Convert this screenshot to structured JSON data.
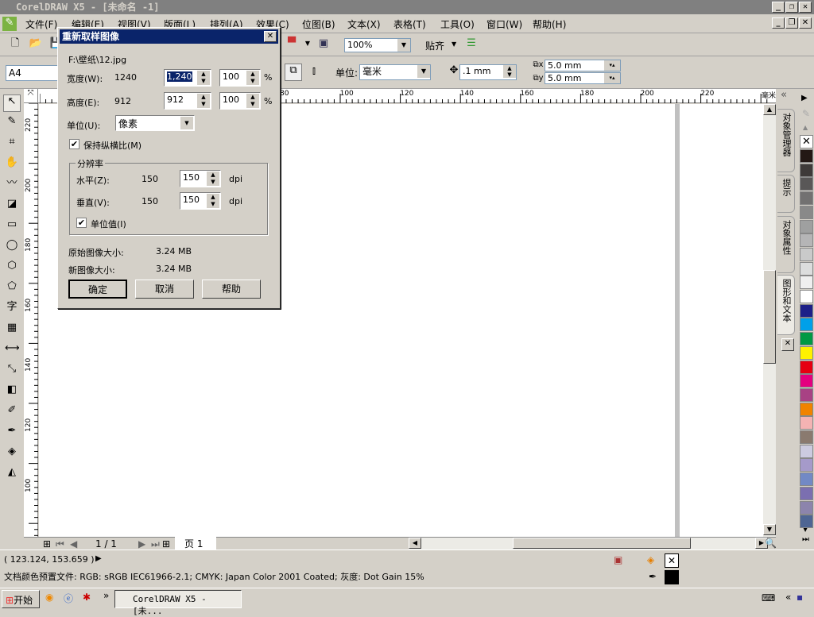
{
  "window": {
    "title": "CorelDRAW X5 - [未命名 -1]"
  },
  "menu": [
    "文件(F)",
    "编辑(E)",
    "视图(V)",
    "版面(L)",
    "排列(A)",
    "效果(C)",
    "位图(B)",
    "文本(X)",
    "表格(T)",
    "工具(O)",
    "窗口(W)",
    "帮助(H)"
  ],
  "toolbar": {
    "zoom": "100%",
    "snap": "贴齐"
  },
  "propbar": {
    "page_size": "A4",
    "unit_label": "单位:",
    "unit": "毫米",
    "nudge": ".1 mm",
    "dup_x": "5.0 mm",
    "dup_y": "5.0 mm"
  },
  "ruler": {
    "top": [
      "80",
      "100",
      "120",
      "140",
      "160",
      "180",
      "200",
      "220"
    ],
    "left": [
      "220",
      "200",
      "180",
      "160",
      "140",
      "120",
      "100"
    ],
    "unit": "毫米"
  },
  "tools": [
    "pick",
    "shape",
    "crop",
    "pan",
    "freehand",
    "smart-fill",
    "rectangle",
    "ellipse",
    "polygon",
    "basic-shapes",
    "字",
    "table",
    "dimension",
    "connector",
    "blend",
    "eyedropper",
    "outline",
    "fill",
    "interactive-fill"
  ],
  "pages": {
    "counter": "1 / 1",
    "tab": "页 1"
  },
  "dockers": [
    "对象管理器",
    "提示",
    "对象属性",
    "图形和文本"
  ],
  "palette": [
    "#231815",
    "#3e3a39",
    "#595757",
    "#727171",
    "#898989",
    "#9fa0a0",
    "#b5b5b6",
    "#c9caca",
    "#dcdddd",
    "#efefef",
    "#ffffff",
    "#1d2088",
    "#00a0e9",
    "#009944",
    "#fff100",
    "#e60012",
    "#e4007f",
    "#a84284",
    "#f08300",
    "#f4b3b3",
    "#8a7a6f",
    "#cccbe0",
    "#a59aca",
    "#7289c5",
    "#7b6fb0",
    "#8c84ac",
    "#4e6593"
  ],
  "status": {
    "coords": "( 123.124, 153.659 )",
    "profile": "文档颜色预置文件: RGB: sRGB IEC61966-2.1; CMYK: Japan Color 2001 Coated; 灰度: Dot Gain 15%"
  },
  "taskbar": {
    "start": "开始",
    "task": "CorelDRAW X5 - [未..."
  },
  "dialog": {
    "title": "重新取样图像",
    "file": "F:\\壁纸\\12.jpg",
    "width_label": "宽度(W):",
    "width_orig": "1240",
    "width_value": "1,240",
    "width_pct": "100",
    "height_label": "高度(E):",
    "height_orig": "912",
    "height_value": "912",
    "height_pct": "100",
    "pct": "%",
    "unit_label": "单位(U):",
    "unit_value": "像素",
    "keep_ratio": "保持纵横比(M)",
    "res_group": "分辨率",
    "h_label": "水平(Z):",
    "h_orig": "150",
    "h_value": "150",
    "v_label": "垂直(V):",
    "v_orig": "150",
    "v_value": "150",
    "dpi": "dpi",
    "unit_values": "单位值(I)",
    "orig_size_label": "原始图像大小:",
    "orig_size": "3.24 MB",
    "new_size_label": "新图像大小:",
    "new_size": "3.24 MB",
    "ok": "确定",
    "cancel": "取消",
    "help": "帮助"
  }
}
